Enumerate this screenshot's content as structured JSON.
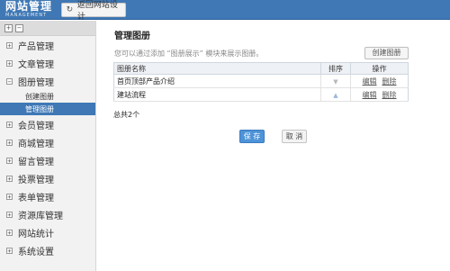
{
  "header": {
    "brand": "网站管理",
    "brand_sub": "MANAGEMENT",
    "back_label": "返回网站设计",
    "back_icon": "refresh-icon"
  },
  "sidebar": {
    "items": [
      {
        "label": "产品管理",
        "expander": "+"
      },
      {
        "label": "文章管理",
        "expander": "+"
      },
      {
        "label": "图册管理",
        "expander": "−"
      },
      {
        "label": "会员管理",
        "expander": "+"
      },
      {
        "label": "商城管理",
        "expander": "+"
      },
      {
        "label": "留言管理",
        "expander": "+"
      },
      {
        "label": "投票管理",
        "expander": "+"
      },
      {
        "label": "表单管理",
        "expander": "+"
      },
      {
        "label": "资源库管理",
        "expander": "+"
      },
      {
        "label": "网站统计",
        "expander": "+"
      },
      {
        "label": "系统设置",
        "expander": "+"
      }
    ],
    "sub_items": [
      {
        "label": "创建图册"
      },
      {
        "label": "管理图册"
      }
    ]
  },
  "main": {
    "title": "管理图册",
    "hint": "您可以通过添加 “图册展示” 模块来展示图册。",
    "create_label": "创建图册",
    "table": {
      "headers": [
        "图册名称",
        "排序",
        "操作"
      ],
      "rows": [
        {
          "name": "首页顶部产品介绍",
          "edit": "编辑",
          "delete": "删除"
        },
        {
          "name": "建站流程",
          "edit": "编辑",
          "delete": "删除"
        }
      ]
    },
    "total": "总共2个",
    "save_label": "保 存",
    "cancel_label": "取 消"
  },
  "colors": {
    "accent": "#3f78b5",
    "primary_button": "#4d93d8"
  }
}
